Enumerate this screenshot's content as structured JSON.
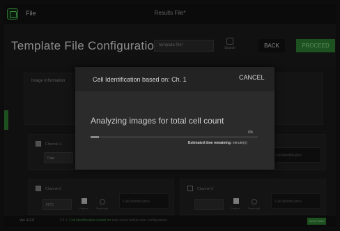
{
  "window": {
    "title": "Results File*",
    "menu_file": "File"
  },
  "header": {
    "page_title": "Template File Configuration",
    "template_select_value": "template-file*",
    "search_label": "Search",
    "back_label": "BACK",
    "proceed_label": "PROCEED"
  },
  "main": {
    "image_info_title": "Image Information",
    "channels": [
      {
        "label": "Channel 1",
        "field": "Dapi",
        "right_field": "Cell Identification"
      },
      {
        "label": "Channel 2",
        "field": "FITC",
        "mini_a": "Custom",
        "mini_b": "Threshold",
        "right_field": "Cell identification"
      },
      {
        "label": "Channel 3",
        "field": "",
        "mini_a": "Custom",
        "mini_b": "Threshold",
        "right_field": "Cell identification"
      }
    ]
  },
  "dialog": {
    "title": "Cell Identification based on: Ch. 1",
    "cancel_label": "CANCEL",
    "message": "Analyzing images for total cell count",
    "progress_percent_text": "0%",
    "progress_fraction": 0.05,
    "eta_label": "Estimated time remaining:",
    "eta_value": "minute(s)"
  },
  "statusbar": {
    "version": "Ver. 4.2.0",
    "message_prefix": "Ch 1:",
    "message_highlight": "Cell identification based on",
    "message_suffix": "total count before user configuration",
    "button_label": "Open Folder"
  },
  "colors": {
    "accent": "#2e7d32",
    "background": "#161616",
    "dialog": "#2b2b2b"
  }
}
